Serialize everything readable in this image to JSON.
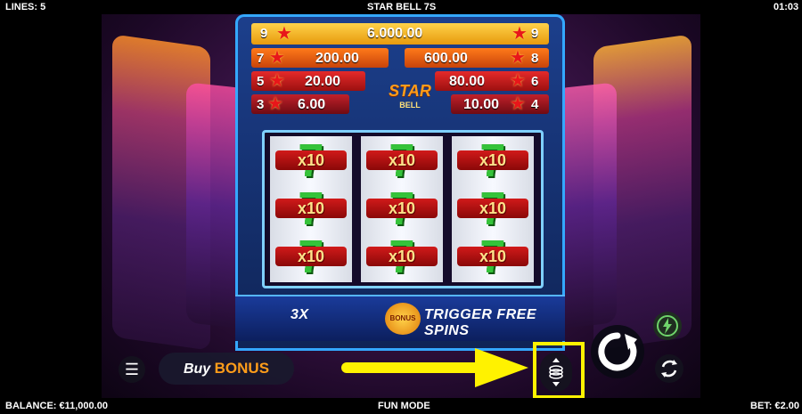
{
  "topbar": {
    "lines": "LINES: 5",
    "title": "STAR BELL 7S",
    "clock": "01:03"
  },
  "bottombar": {
    "balance": "BALANCE: €11,000.00",
    "mode": "FUN MODE",
    "bet": "BET: €2.00"
  },
  "paytable": {
    "row9": {
      "left": "9",
      "right": "9",
      "value": "6.000.00"
    },
    "row7": {
      "num": "7",
      "value": "200.00"
    },
    "row8": {
      "num": "8",
      "value": "600.00"
    },
    "row5": {
      "num": "5",
      "value": "20.00"
    },
    "row6": {
      "num": "6",
      "value": "80.00"
    },
    "row3": {
      "num": "3",
      "value": "6.00"
    },
    "row4": {
      "num": "4",
      "value": "10.00"
    }
  },
  "logo": {
    "line1": "STAR",
    "line2": "BELL"
  },
  "reels": {
    "multiplier": "x10"
  },
  "banner": {
    "prefix": "3X",
    "badge": "BONUS",
    "text": "TRIGGER FREE SPINS"
  },
  "controls": {
    "buy_prefix": "Buy",
    "buy_bonus": "BONUS"
  },
  "colors": {
    "highlight": "#fff200",
    "accent": "#ff9d1a",
    "reel_symbol": "#35c33a"
  }
}
